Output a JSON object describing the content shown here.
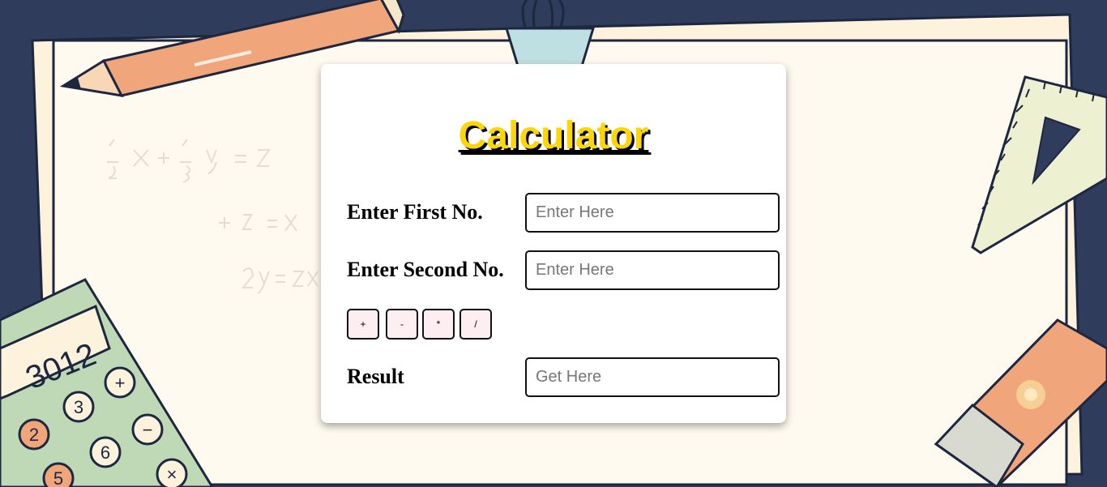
{
  "title": "Calculator",
  "first_label": "Enter First No.",
  "first_placeholder": "Enter Here",
  "second_label": "Enter Second No.",
  "second_placeholder": "Enter Here",
  "operators": [
    "+",
    "-",
    "*",
    "/"
  ],
  "result_label": "Result",
  "result_placeholder": "Get Here",
  "colors": {
    "background": "#2f3c5c",
    "paper": "#fffaf0",
    "title": "#ffd700",
    "operator_button": "#fdeef2"
  },
  "decorations": {
    "calculator_display": "3012",
    "calculator_keys": [
      "3",
      "2",
      "+",
      "6",
      "5",
      "−",
      "×"
    ]
  }
}
